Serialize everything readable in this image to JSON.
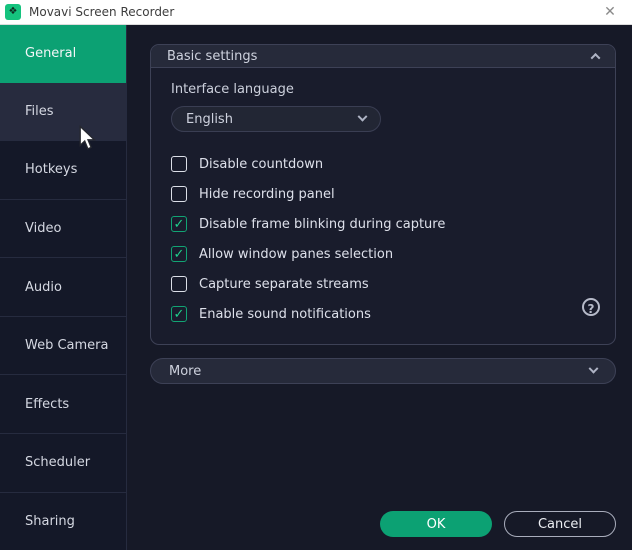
{
  "window": {
    "title": "Movavi Screen Recorder",
    "app_icon_glyph": "❖",
    "close_icon_glyph": "✕"
  },
  "sidebar": {
    "items": [
      {
        "label": "General",
        "state": "selected"
      },
      {
        "label": "Files",
        "state": "hover"
      },
      {
        "label": "Hotkeys",
        "state": "normal"
      },
      {
        "label": "Video",
        "state": "normal"
      },
      {
        "label": "Audio",
        "state": "normal"
      },
      {
        "label": "Web Camera",
        "state": "normal"
      },
      {
        "label": "Effects",
        "state": "normal"
      },
      {
        "label": "Scheduler",
        "state": "normal"
      },
      {
        "label": "Sharing",
        "state": "normal"
      }
    ]
  },
  "panel": {
    "title": "Basic settings",
    "collapse_icon": "chevron-up",
    "language_label": "Interface language",
    "language_value": "English",
    "checkboxes": [
      {
        "label": "Disable countdown",
        "checked": false
      },
      {
        "label": "Hide recording panel",
        "checked": false
      },
      {
        "label": "Disable frame blinking during capture",
        "checked": true
      },
      {
        "label": "Allow window panes selection",
        "checked": true
      },
      {
        "label": "Capture separate streams",
        "checked": false
      },
      {
        "label": "Enable sound notifications",
        "checked": true
      }
    ],
    "check_glyph": "✓",
    "help_glyph": "?"
  },
  "more": {
    "label": "More",
    "expand_icon": "chevron-down"
  },
  "buttons": {
    "ok": "OK",
    "cancel": "Cancel"
  },
  "colors": {
    "accent_green": "#0ca173",
    "check_green": "#21d08c",
    "sidebar_bg": "#141828",
    "panel_bg": "#191c2c",
    "panel_border": "#3d4156",
    "titlebar_bg": "#ffffff"
  }
}
